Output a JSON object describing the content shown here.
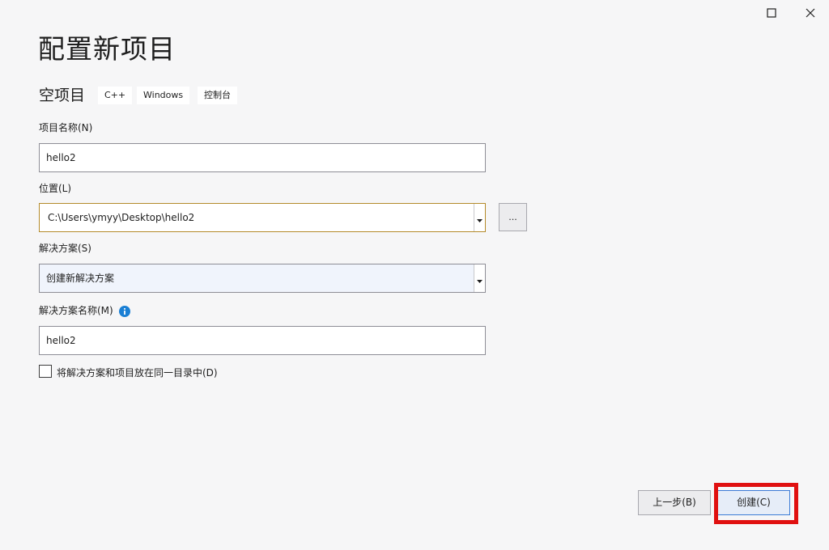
{
  "window": {
    "maximize_icon": "maximize-icon",
    "close_icon": "close-icon"
  },
  "title": "配置新项目",
  "subtitle": "空项目",
  "tags": [
    "C++",
    "Windows",
    "控制台"
  ],
  "project_name": {
    "label": "项目名称(N)",
    "value": "hello2"
  },
  "location": {
    "label": "位置(L)",
    "value": "C:\\Users\\ymyy\\Desktop\\hello2",
    "browse_label": "..."
  },
  "solution": {
    "label": "解决方案(S)",
    "value": "创建新解决方案"
  },
  "solution_name": {
    "label": "解决方案名称(M)",
    "value": "hello2",
    "info_icon": "info-icon"
  },
  "same_dir_checkbox": {
    "label": "将解决方案和项目放在同一目录中(D)",
    "checked": false
  },
  "buttons": {
    "back": "上一步(B)",
    "create": "创建(C)"
  },
  "colors": {
    "highlight": "#e01010",
    "location_border": "#b48a2a",
    "info_blue": "#1a7fd4"
  }
}
